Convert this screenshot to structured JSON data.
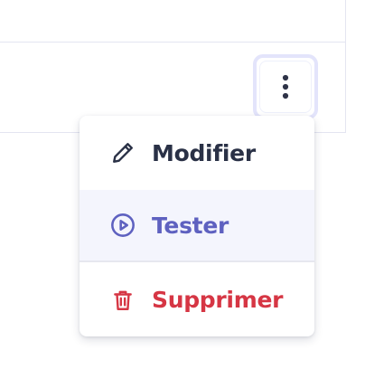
{
  "colors": {
    "edit": "#2a3146",
    "test": "#5e61c0",
    "delete": "#d63644",
    "hover_bg": "#f4f5fd",
    "kebab_dots": "#2f3448"
  },
  "row_actions": {
    "more_button_icon": "more-vertical-icon"
  },
  "menu": {
    "items": [
      {
        "label": "Modifier",
        "icon": "pencil-icon"
      },
      {
        "label": "Tester",
        "icon": "play-circle-icon",
        "highlighted": true
      },
      {
        "label": "Supprimer",
        "icon": "trash-icon"
      }
    ]
  }
}
